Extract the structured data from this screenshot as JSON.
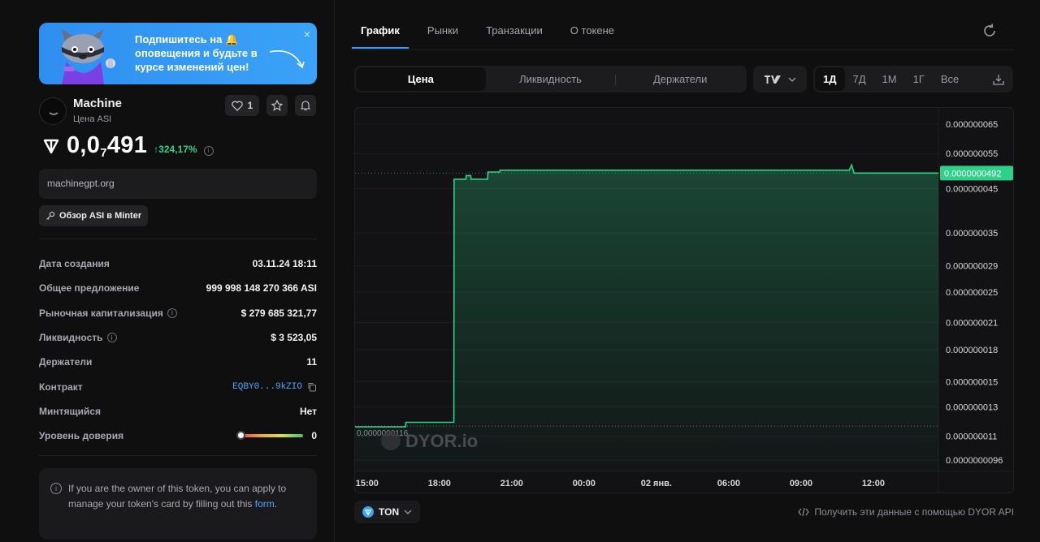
{
  "banner": {
    "text": "Подпишитесь на 🔔 оповещения и будьте в курсе изменений цен!",
    "close": "×"
  },
  "token": {
    "name": "Machine",
    "subtitle": "Цена ASI",
    "likes": "1",
    "price_prefix": "0,0",
    "price_zeros": "7",
    "price_tail": "491",
    "change": "↑324,17%",
    "site": "machinegpt.org",
    "minter_button": "Обзор ASI в Minter"
  },
  "stats": [
    {
      "label": "Дата создания",
      "value": "03.11.24 18:11"
    },
    {
      "label": "Общее предложение",
      "value": "999 998 148 270 366 ASI"
    },
    {
      "label": "Рыночная капитализация",
      "value": "$ 279 685 321,77"
    },
    {
      "label": "Ликвидность",
      "value": "$ 3 523,05"
    },
    {
      "label": "Держатели",
      "value": "11"
    },
    {
      "label": "Контракт",
      "value": "EQBY0...9kZIO"
    },
    {
      "label": "Минтящийся",
      "value": "Нет"
    },
    {
      "label": "Уровень доверия",
      "value": "0"
    }
  ],
  "owner": {
    "text": "If you are the owner of this token, you can apply to manage your token's card by filling out this ",
    "link": "form",
    "end": "."
  },
  "tabs": [
    "График",
    "Рынки",
    "Транзакции",
    "О токене"
  ],
  "segments": [
    "Цена",
    "Ликвидность",
    "Держатели"
  ],
  "timeframes": [
    "1Д",
    "7Д",
    "1М",
    "1Г",
    "Все"
  ],
  "chart_type_icon": "trading-view-icon",
  "watermark": "DYOR.io",
  "currency": "TON",
  "api_link": "Получить эти данные с помощью DYOR API",
  "colors": {
    "accent": "#3b9cff",
    "line": "#2fd08a",
    "positive": "#2fd08a"
  },
  "chart_data": {
    "type": "area",
    "y_scale": "log",
    "y_ticks": [
      "0.000000065",
      "0.000000055",
      "0.000000045",
      "0.000000035",
      "0.000000029",
      "0.000000025",
      "0.000000021",
      "0.000000018",
      "0.000000015",
      "0.000000013",
      "0.000000011",
      "0.0000000096"
    ],
    "y_tick_values": [
      6.5e-08,
      5.5e-08,
      4.5e-08,
      3.5e-08,
      2.9e-08,
      2.5e-08,
      2.1e-08,
      1.8e-08,
      1.5e-08,
      1.3e-08,
      1.1e-08,
      9.6e-09
    ],
    "x_ticks": [
      "15:00",
      "18:00",
      "21:00",
      "00:00",
      "02 янв.",
      "06:00",
      "09:00",
      "12:00"
    ],
    "x_tick_hours": [
      0,
      3,
      6,
      9,
      12,
      15,
      18,
      21
    ],
    "ylim": [
      9e-09,
      7e-08
    ],
    "xlim": [
      -0.5,
      23.7
    ],
    "x_hours": [
      -0.5,
      1.6,
      1.61,
      3.6,
      3.61,
      4.1,
      4.11,
      4.3,
      4.31,
      5.0,
      5.01,
      5.5,
      5.51,
      20.0,
      20.1,
      20.2,
      20.3,
      23.7
    ],
    "y": [
      1.16e-08,
      1.16e-08,
      1.19e-08,
      1.19e-08,
      4.75e-08,
      4.75e-08,
      4.85e-08,
      4.85e-08,
      4.75e-08,
      4.75e-08,
      4.95e-08,
      4.95e-08,
      5e-08,
      5e-08,
      5.15e-08,
      4.92e-08,
      4.92e-08,
      4.92e-08
    ],
    "last_value_label": "0.0000000492",
    "min_value_label": "0,0000000116",
    "min_value": 1.16e-08,
    "last_value": 4.92e-08
  }
}
